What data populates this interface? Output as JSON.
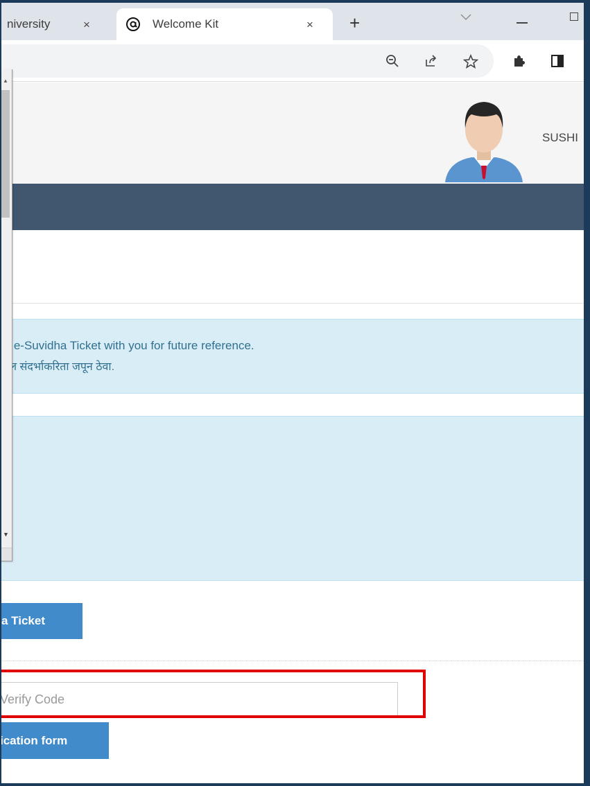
{
  "browser": {
    "tabs": [
      {
        "label": "niversity",
        "active": false
      },
      {
        "label": "Welcome Kit",
        "active": true
      }
    ],
    "close_glyph": "×",
    "new_tab_glyph": "+",
    "favicon": "at-sign-icon"
  },
  "toolbar": {
    "icons": [
      "zoom-out-icon",
      "share-icon",
      "star-icon",
      "extensions-icon",
      "side-panel-icon"
    ]
  },
  "header": {
    "username": "SUSHI",
    "avatar": "user-avatar"
  },
  "notice": {
    "line1": "ur e-Suvidha Ticket with you for future reference.",
    "line2": "तील संदर्भाकरिता जपून ठेवा."
  },
  "actions": {
    "ticket_button": "a Ticket",
    "verify_placeholder": "Verify Code",
    "form_button": "ication form"
  },
  "colors": {
    "navbar": "#41566f",
    "info_bg": "#d9edf6",
    "button": "#428bca",
    "highlight": "#e00000"
  }
}
